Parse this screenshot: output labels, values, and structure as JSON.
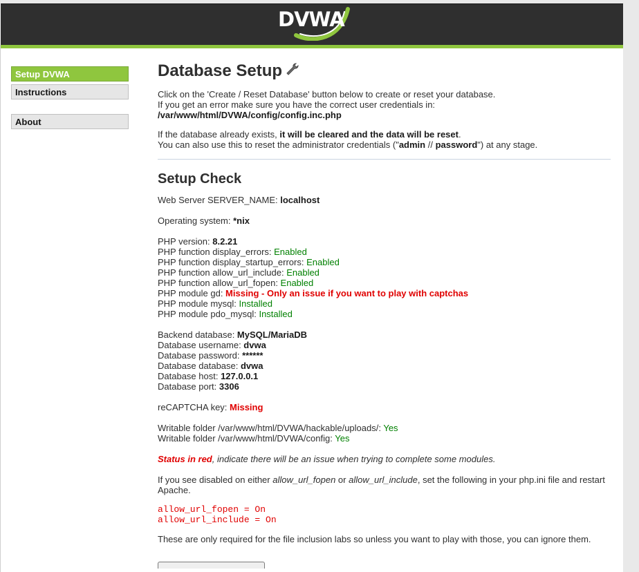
{
  "header": {
    "logo_text": "DVWA"
  },
  "menu": {
    "items": [
      {
        "label": "Setup DVWA"
      },
      {
        "label": "Instructions"
      },
      {
        "label": "About"
      }
    ]
  },
  "page": {
    "title": "Database Setup",
    "intro_1": "Click on the 'Create / Reset Database' button below to create or reset your database.",
    "intro_2_pre": "If you get an error make sure you have the correct user credentials in: ",
    "intro_2_path": "/var/www/html/DVWA/config/config.inc.php",
    "intro_3_pre": "If the database already exists, ",
    "intro_3_bold": "it will be cleared and the data will be reset",
    "intro_3_post": ".",
    "intro_4_pre": "You can also use this to reset the administrator credentials (\"",
    "intro_4_user": "admin",
    "intro_4_sep": " // ",
    "intro_4_pass": "password",
    "intro_4_post": "\") at any stage."
  },
  "setup_check": {
    "title": "Setup Check",
    "server_name_label": "Web Server SERVER_NAME: ",
    "server_name_value": "localhost",
    "os_label": "Operating system: ",
    "os_value": "*nix",
    "php_version_label": "PHP version: ",
    "php_version_value": "8.2.21",
    "php_checks": [
      {
        "label": "PHP function display_errors: ",
        "value": "Enabled",
        "status": "ok"
      },
      {
        "label": "PHP function display_startup_errors: ",
        "value": "Enabled",
        "status": "ok"
      },
      {
        "label": "PHP function allow_url_include: ",
        "value": "Enabled",
        "status": "ok"
      },
      {
        "label": "PHP function allow_url_fopen: ",
        "value": "Enabled",
        "status": "ok"
      },
      {
        "label": "PHP module gd: ",
        "value": "Missing - Only an issue if you want to play with captchas",
        "status": "bad"
      },
      {
        "label": "PHP module mysql: ",
        "value": "Installed",
        "status": "ok"
      },
      {
        "label": "PHP module pdo_mysql: ",
        "value": "Installed",
        "status": "ok"
      }
    ],
    "db": [
      {
        "label": "Backend database: ",
        "value": "MySQL/MariaDB"
      },
      {
        "label": "Database username: ",
        "value": "dvwa"
      },
      {
        "label": "Database password: ",
        "value": "******"
      },
      {
        "label": "Database database: ",
        "value": "dvwa"
      },
      {
        "label": "Database host: ",
        "value": "127.0.0.1"
      },
      {
        "label": "Database port: ",
        "value": "3306"
      }
    ],
    "recaptcha_label": "reCAPTCHA key: ",
    "recaptcha_value": "Missing",
    "folders": [
      {
        "label": "Writable folder /var/www/html/DVWA/hackable/uploads/: ",
        "value": "Yes"
      },
      {
        "label": "Writable folder /var/www/html/DVWA/config: ",
        "value": "Yes"
      }
    ],
    "status_note_bold": "Status in red",
    "status_note_rest": ", indicate there will be an issue when trying to complete some modules.",
    "disabled_pre": "If you see disabled on either ",
    "disabled_fopen": "allow_url_fopen",
    "disabled_or": " or ",
    "disabled_include": "allow_url_include",
    "disabled_post": ", set the following in your php.ini file and restart Apache.",
    "code_lines": [
      "allow_url_fopen = On",
      "allow_url_include = On"
    ],
    "labs_note": "These are only required for the file inclusion labs so unless you want to play with those, you can ignore them."
  },
  "colors": {
    "accent": "#8fc63e",
    "header_bg": "#2f2f2f",
    "ok": "#008000",
    "bad": "#e00000"
  }
}
